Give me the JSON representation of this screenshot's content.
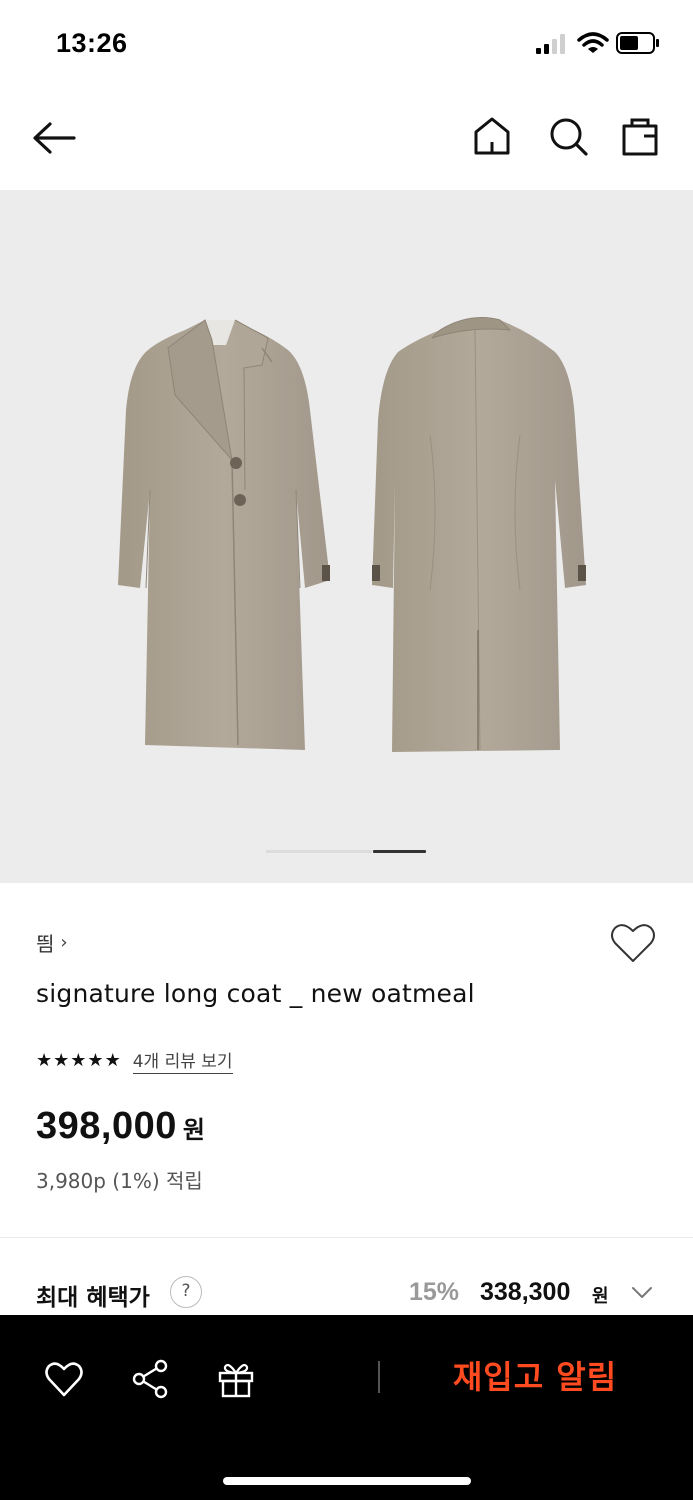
{
  "status_bar": {
    "time": "13:26"
  },
  "product": {
    "brand": "띔",
    "title": "signature long coat _ new oatmeal",
    "rating_stars": 5,
    "review_link": "4개 리뷰 보기",
    "price": "398,000",
    "currency": "원",
    "points": "3,980p (1%) 적립"
  },
  "gallery": {
    "image_count": 2,
    "active_index": 2
  },
  "benefit": {
    "label": "최대 혜택가",
    "help": "?",
    "discount_pct": "15%",
    "discount_price": "338,300",
    "currency": "원"
  },
  "bottom_bar": {
    "action_label": "재입고 알림"
  },
  "colors": {
    "accent": "#ff4b1f",
    "bottom_bar_bg": "#000000",
    "gallery_bg": "#ececed",
    "coat": "#aca294"
  }
}
